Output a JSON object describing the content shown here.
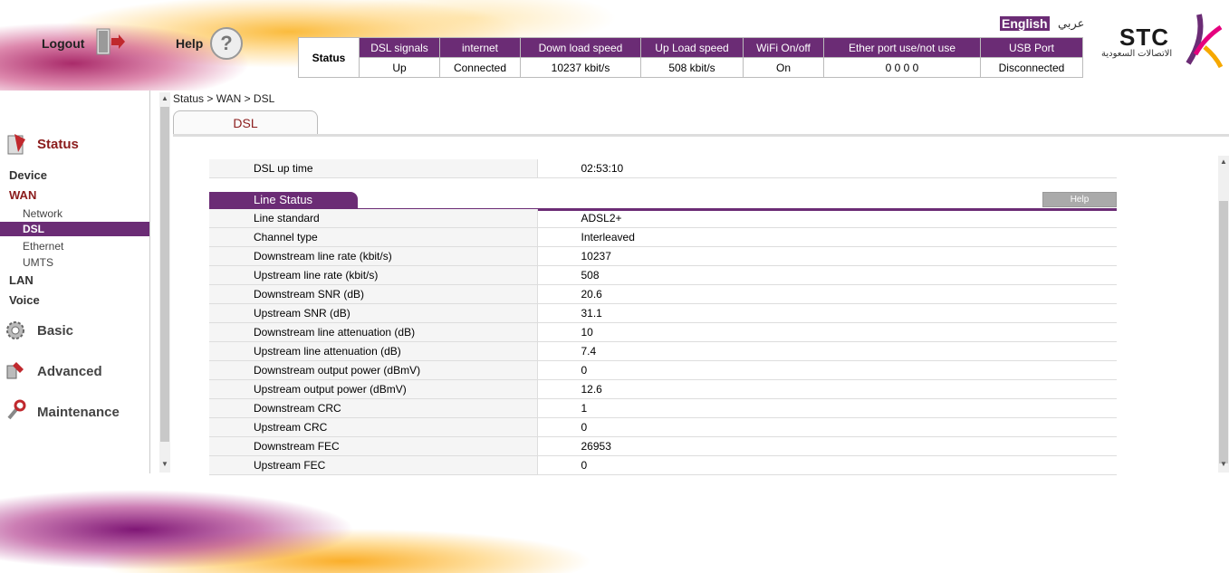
{
  "header": {
    "logout_label": "Logout",
    "help_label": "Help",
    "help_glyph": "?",
    "lang_english": "English",
    "lang_arabic": "عربي",
    "logo_text": "STC",
    "logo_sub": "الاتصالات السعودية",
    "status_label": "Status",
    "status_columns": [
      "DSL signals",
      "internet",
      "Down load speed",
      "Up Load speed",
      "WiFi On/off",
      "Ether port use/not use",
      "USB Port"
    ],
    "status_values": [
      "Up",
      "Connected",
      "10237 kbit/s",
      "508 kbit/s",
      "On",
      "0 0 0 0",
      "Disconnected"
    ]
  },
  "sidebar": {
    "status_label": "Status",
    "device_label": "Device",
    "wan_label": "WAN",
    "wan_items": [
      "Network",
      "DSL",
      "Ethernet",
      "UMTS"
    ],
    "lan_label": "LAN",
    "voice_label": "Voice",
    "basic_label": "Basic",
    "advanced_label": "Advanced",
    "maintenance_label": "Maintenance"
  },
  "main": {
    "breadcrumb": "Status > WAN > DSL",
    "tab_label": "DSL",
    "top_rows": [
      {
        "label": "DSL up time",
        "value": "02:53:10"
      }
    ],
    "line_status_title": "Line Status",
    "help_button": "Help",
    "line_status_rows": [
      {
        "label": "Line standard",
        "value": "ADSL2+"
      },
      {
        "label": "Channel type",
        "value": "Interleaved"
      },
      {
        "label": "Downstream line rate (kbit/s)",
        "value": "10237"
      },
      {
        "label": "Upstream line rate (kbit/s)",
        "value": "508"
      },
      {
        "label": "Downstream SNR (dB)",
        "value": "20.6"
      },
      {
        "label": "Upstream SNR (dB)",
        "value": "31.1"
      },
      {
        "label": "Downstream line attenuation (dB)",
        "value": "10"
      },
      {
        "label": "Upstream line attenuation (dB)",
        "value": "7.4"
      },
      {
        "label": "Downstream output power (dBmV)",
        "value": "0"
      },
      {
        "label": "Upstream output power (dBmV)",
        "value": "12.6"
      },
      {
        "label": "Downstream CRC",
        "value": "1"
      },
      {
        "label": "Upstream CRC",
        "value": "0"
      },
      {
        "label": "Downstream FEC",
        "value": "26953"
      },
      {
        "label": "Upstream FEC",
        "value": "0"
      }
    ]
  },
  "colors": {
    "accent": "#6b2c75"
  }
}
